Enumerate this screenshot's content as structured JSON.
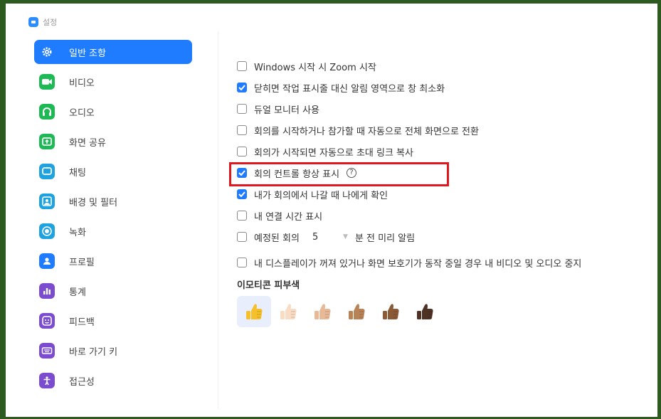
{
  "window": {
    "title": "설정"
  },
  "sidebar": {
    "items": [
      {
        "label": "일반 조항",
        "icon": "gear-icon",
        "color": "#ffffff",
        "active": true
      },
      {
        "label": "비디오",
        "icon": "video-camera-icon",
        "color": "#1db954"
      },
      {
        "label": "오디오",
        "icon": "headphones-icon",
        "color": "#1db954"
      },
      {
        "label": "화면 공유",
        "icon": "screen-share-icon",
        "color": "#1db954"
      },
      {
        "label": "채팅",
        "icon": "chat-icon",
        "color": "#1fa2e0"
      },
      {
        "label": "배경 및 필터",
        "icon": "background-filter-icon",
        "color": "#1fa2e0"
      },
      {
        "label": "녹화",
        "icon": "record-icon",
        "color": "#1fa2e0"
      },
      {
        "label": "프로필",
        "icon": "profile-icon",
        "color": "#1f7cff"
      },
      {
        "label": "통계",
        "icon": "statistics-icon",
        "color": "#7b4ccf"
      },
      {
        "label": "피드백",
        "icon": "feedback-icon",
        "color": "#7b4ccf"
      },
      {
        "label": "바로 가기 키",
        "icon": "keyboard-icon",
        "color": "#7b4ccf"
      },
      {
        "label": "접근성",
        "icon": "accessibility-icon",
        "color": "#7b4ccf"
      }
    ]
  },
  "general": {
    "options": [
      {
        "label": "Windows 시작 시 Zoom 시작",
        "checked": false
      },
      {
        "label": "닫히면 작업 표시줄 대신 알림 영역으로 창 최소화",
        "checked": true
      },
      {
        "label": "듀얼 모니터 사용",
        "checked": false
      },
      {
        "label": "회의를 시작하거나 참가할 때 자동으로 전체 화면으로 전환",
        "checked": false
      },
      {
        "label": "회의가 시작되면 자동으로 초대 링크 복사",
        "checked": false
      },
      {
        "label": "회의 컨트롤 항상 표시",
        "checked": true,
        "help": "?"
      },
      {
        "label": "내가 회의에서 나갈 때 나에게 확인",
        "checked": true
      },
      {
        "label": "내 연결 시간 표시",
        "checked": false
      }
    ],
    "reminder": {
      "prefix": "예정된 회의",
      "value": "5",
      "suffix": "분 전 미리 알림",
      "checked": false
    },
    "screensaver": {
      "label": "내 디스플레이가 꺼져 있거나 화면 보호기가 동작 중일 경우 내 비디오 및 오디오 중지",
      "checked": false
    },
    "skin_tone": {
      "title": "이모티콘 피부색",
      "tones": [
        "#f6c02b",
        "#f9dcc4",
        "#e7b996",
        "#b98358",
        "#8b5a36",
        "#4e3325"
      ],
      "selected_index": 0
    }
  },
  "highlight_color": "#e1171f"
}
